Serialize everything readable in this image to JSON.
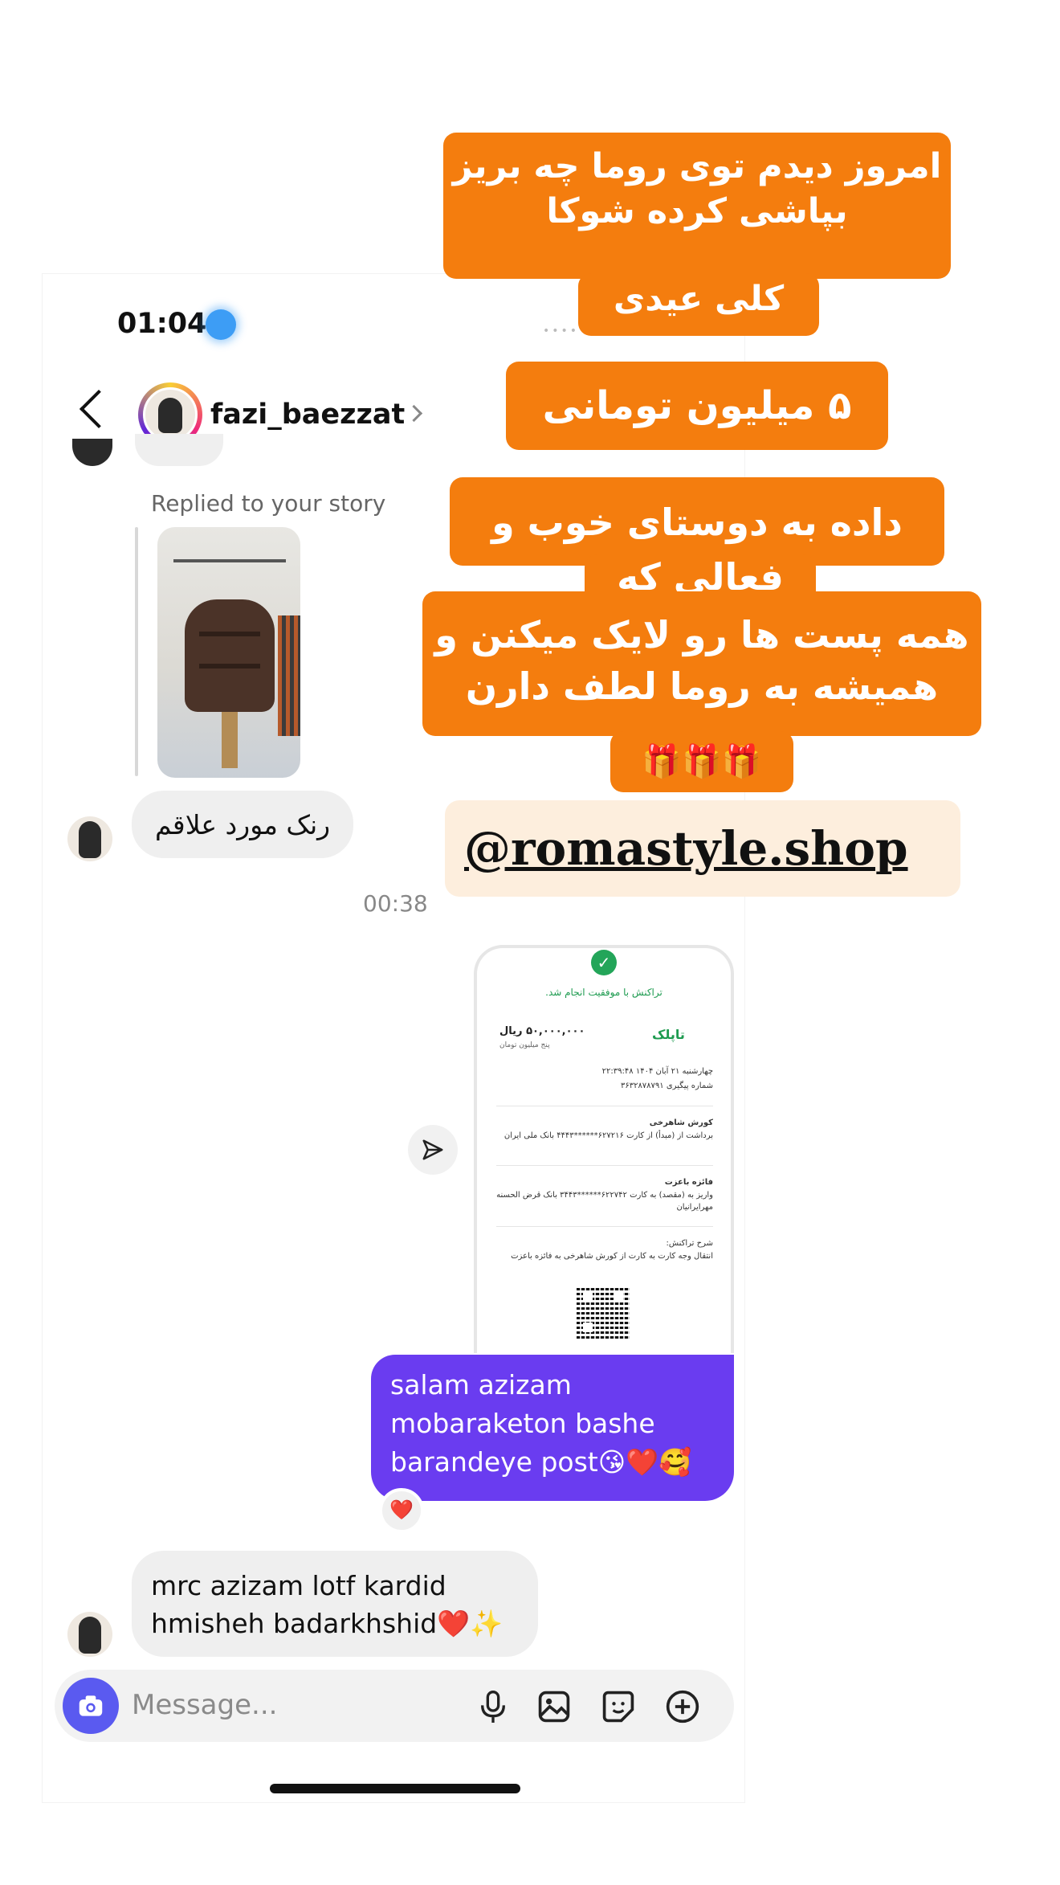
{
  "status_bar": {
    "time": "01:04"
  },
  "header": {
    "username": "fazi_baezzat"
  },
  "thread": {
    "replied_label": "Replied to your story",
    "msg_them_1": "رنک مورد علاقم",
    "timestamp": "00:38",
    "receipt": {
      "title": "تراکنش با موفقیت انجام شد.",
      "bank": "تاپلک",
      "amount": "۵۰,۰۰۰,۰۰۰ ریال",
      "amount_words": "پنج میلیون تومان",
      "date": "چهارشنبه ۲۱ آبان ۱۴۰۴ ۲۲:۳۹:۴۸",
      "tracking": "شماره پیگیری ۳۶۳۲۸۷۸۷۹۱",
      "from_name": "کورش شاهرخی",
      "from_label": "برداشت از (مبدأ) از کارت ۶۲۷۲۱۶******۴۴۴۳ بانک ملی ایران",
      "to_name": "فائزه باعزت",
      "to_label": "واریز به (مقصد) به کارت ۶۲۲۷۴۲******۳۴۴۳ بانک قرض الحسنه مهرایرانیان",
      "desc_label": "شرح تراکنش:",
      "desc": "انتقال وجه کارت به کارت از کورش شاهرخی به فائزه باعزت"
    },
    "msg_me": [
      "salam azizam",
      "mobaraketon bashe",
      "barandeye post😘❤️🥰"
    ],
    "reaction": "❤️",
    "msg_them_2": [
      "mrc azizam lotf kardid",
      "hmisheh badarkhshid❤️✨"
    ]
  },
  "composer": {
    "placeholder": "Message..."
  },
  "overlay": {
    "line1": "امروز دیدم توی روما چه بریز بپاشی کرده شوکا",
    "line1b": "کلی عیدی",
    "line2": "۵ میلیون تومانی",
    "line3": "داده به دوستای خوب و",
    "line3b": "فعالی که",
    "line4": "همه پست ها رو لایک میکنن و همیشه به روما لطف دارن",
    "line4b": "🎁🎁🎁",
    "handle": "@romastyle.shop"
  },
  "colors": {
    "overlay_orange": "#f47d0e",
    "my_bubble": "#6a3cf0",
    "accent_blue": "#3d9df5"
  }
}
